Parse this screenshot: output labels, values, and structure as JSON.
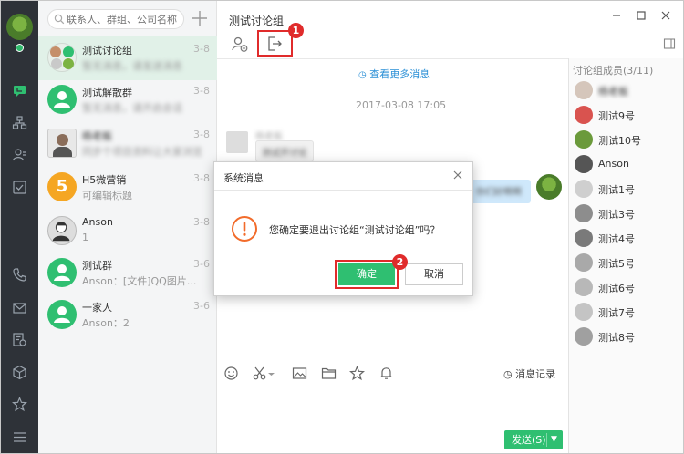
{
  "colors": {
    "accent": "#2fbf71",
    "highlight": "#e02b2b",
    "rail": "#2e3238",
    "link": "#2a8fd6"
  },
  "search": {
    "placeholder": "联系人、群组、公司名称"
  },
  "conversations": [
    {
      "name": "测试讨论组",
      "sub": "暂无消息，请发送消息",
      "date": "3-8"
    },
    {
      "name": "测试解散群",
      "sub": "暂无消息，请开启会话",
      "date": "3-8"
    },
    {
      "name": "杨老板",
      "sub": "同步个项目资料让大家浏览",
      "date": "3-8"
    },
    {
      "name": "H5微营销",
      "sub": "可编辑标题",
      "date": "3-8",
      "avatar_letter": "5"
    },
    {
      "name": "Anson",
      "sub": "1",
      "date": "3-8"
    },
    {
      "name": "测试群",
      "sub": "Anson：[文件]QQ图片...",
      "date": "3-6"
    },
    {
      "name": "一家人",
      "sub": "Anson：2",
      "date": "3-6"
    }
  ],
  "chat": {
    "title": "测试讨论组",
    "more_messages": "查看更多消息",
    "timestamp": "2017-03-08 17:05",
    "other_name": "杨老板",
    "other_message": "测试开讨论",
    "my_message": "你们好啊啊",
    "history_label": "消息记录",
    "send_label": "发送(S)"
  },
  "members": {
    "header": "讨论组成员(3/11)",
    "list": [
      "杨老板",
      "测试9号",
      "测试10号",
      "Anson",
      "测试1号",
      "测试3号",
      "测试4号",
      "测试5号",
      "测试6号",
      "测试7号",
      "测试8号"
    ]
  },
  "dialog": {
    "title": "系统消息",
    "message": "您确定要退出讨论组“测试讨论组”吗？",
    "ok_label": "确定",
    "cancel_label": "取消"
  },
  "annotations": {
    "step1": "1",
    "step2": "2"
  }
}
